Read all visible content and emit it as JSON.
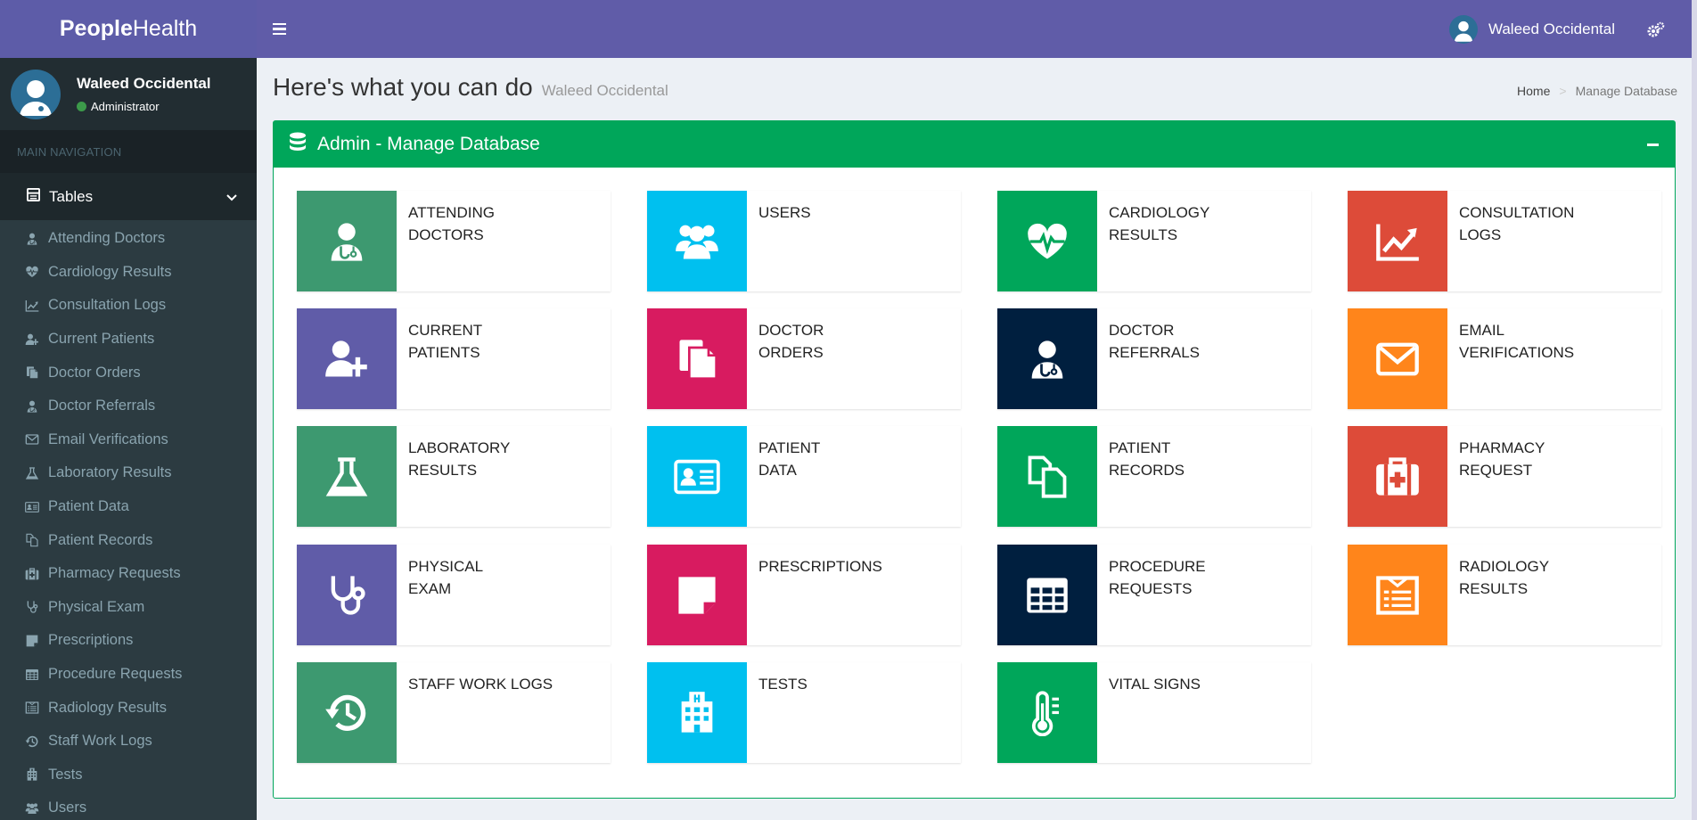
{
  "brand": {
    "bold": "People",
    "light": "Health"
  },
  "sidebar": {
    "user_name": "Waleed Occidental",
    "user_role": "Administrator",
    "nav_header": "MAIN NAVIGATION",
    "tree_label": "Tables",
    "items": [
      {
        "label": "Attending Doctors",
        "icon": "user-doctor-icon"
      },
      {
        "label": "Cardiology Results",
        "icon": "heartbeat-icon"
      },
      {
        "label": "Consultation Logs",
        "icon": "line-chart-icon"
      },
      {
        "label": "Current Patients",
        "icon": "user-plus-icon"
      },
      {
        "label": "Doctor Orders",
        "icon": "copy-icon"
      },
      {
        "label": "Doctor Referrals",
        "icon": "user-doctor-icon"
      },
      {
        "label": "Email Verifications",
        "icon": "envelope-icon"
      },
      {
        "label": "Laboratory Results",
        "icon": "flask-icon"
      },
      {
        "label": "Patient Data",
        "icon": "id-card-icon"
      },
      {
        "label": "Patient Records",
        "icon": "files-icon"
      },
      {
        "label": "Pharmacy Requests",
        "icon": "medkit-icon"
      },
      {
        "label": "Physical Exam",
        "icon": "stethoscope-icon"
      },
      {
        "label": "Prescriptions",
        "icon": "sticky-note-icon"
      },
      {
        "label": "Procedure Requests",
        "icon": "table-icon"
      },
      {
        "label": "Radiology Results",
        "icon": "list-alt-icon"
      },
      {
        "label": "Staff Work Logs",
        "icon": "history-icon"
      },
      {
        "label": "Tests",
        "icon": "hospital-icon"
      },
      {
        "label": "Users",
        "icon": "users-icon"
      }
    ]
  },
  "header": {
    "user_name": "Waleed Occidental"
  },
  "content": {
    "title": "Here's what you can do",
    "subtitle": "Waleed Occidental",
    "breadcrumb": {
      "home": "Home",
      "current": "Manage Database"
    },
    "box_title": "Admin - Manage Database"
  },
  "colors": {
    "header": "#605ca8",
    "box_green": "#00a65a",
    "teal": "#3d9970",
    "aqua": "#00c0ef",
    "green": "#00a65a",
    "red": "#dd4b39",
    "purple": "#605ca8",
    "maroon": "#d81b60",
    "navy": "#001f3f",
    "orange": "#ff851b"
  },
  "tiles": [
    {
      "line1": "ATTENDING",
      "line2": "DOCTORS",
      "color": "#3d9970",
      "icon": "user-doctor-icon"
    },
    {
      "line1": "USERS",
      "line2": "",
      "color": "#00c0ef",
      "icon": "users-icon"
    },
    {
      "line1": "CARDIOLOGY",
      "line2": "RESULTS",
      "color": "#00a65a",
      "icon": "heartbeat-icon"
    },
    {
      "line1": "CONSULTATION",
      "line2": "LOGS",
      "color": "#dd4b39",
      "icon": "line-chart-icon"
    },
    {
      "line1": "CURRENT",
      "line2": "PATIENTS",
      "color": "#605ca8",
      "icon": "user-plus-icon"
    },
    {
      "line1": "DOCTOR",
      "line2": "ORDERS",
      "color": "#d81b60",
      "icon": "copy-icon"
    },
    {
      "line1": "DOCTOR",
      "line2": "REFERRALS",
      "color": "#001f3f",
      "icon": "user-doctor-icon"
    },
    {
      "line1": "EMAIL",
      "line2": "VERIFICATIONS",
      "color": "#ff851b",
      "icon": "envelope-icon"
    },
    {
      "line1": "LABORATORY",
      "line2": "RESULTS",
      "color": "#3d9970",
      "icon": "flask-icon"
    },
    {
      "line1": "PATIENT",
      "line2": "DATA",
      "color": "#00c0ef",
      "icon": "id-card-icon"
    },
    {
      "line1": "PATIENT",
      "line2": "RECORDS",
      "color": "#00a65a",
      "icon": "files-icon"
    },
    {
      "line1": "PHARMACY",
      "line2": "REQUEST",
      "color": "#dd4b39",
      "icon": "medkit-icon"
    },
    {
      "line1": "PHYSICAL",
      "line2": "EXAM",
      "color": "#605ca8",
      "icon": "stethoscope-icon"
    },
    {
      "line1": "PRESCRIPTIONS",
      "line2": "",
      "color": "#d81b60",
      "icon": "sticky-note-icon"
    },
    {
      "line1": "PROCEDURE",
      "line2": "REQUESTS",
      "color": "#001f3f",
      "icon": "table-icon"
    },
    {
      "line1": "RADIOLOGY",
      "line2": "RESULTS",
      "color": "#ff851b",
      "icon": "list-alt-icon"
    },
    {
      "line1": "STAFF WORK LOGS",
      "line2": "",
      "color": "#3d9970",
      "icon": "history-icon"
    },
    {
      "line1": "TESTS",
      "line2": "",
      "color": "#00c0ef",
      "icon": "hospital-icon"
    },
    {
      "line1": "VITAL SIGNS",
      "line2": "",
      "color": "#00a65a",
      "icon": "thermometer-icon"
    }
  ]
}
